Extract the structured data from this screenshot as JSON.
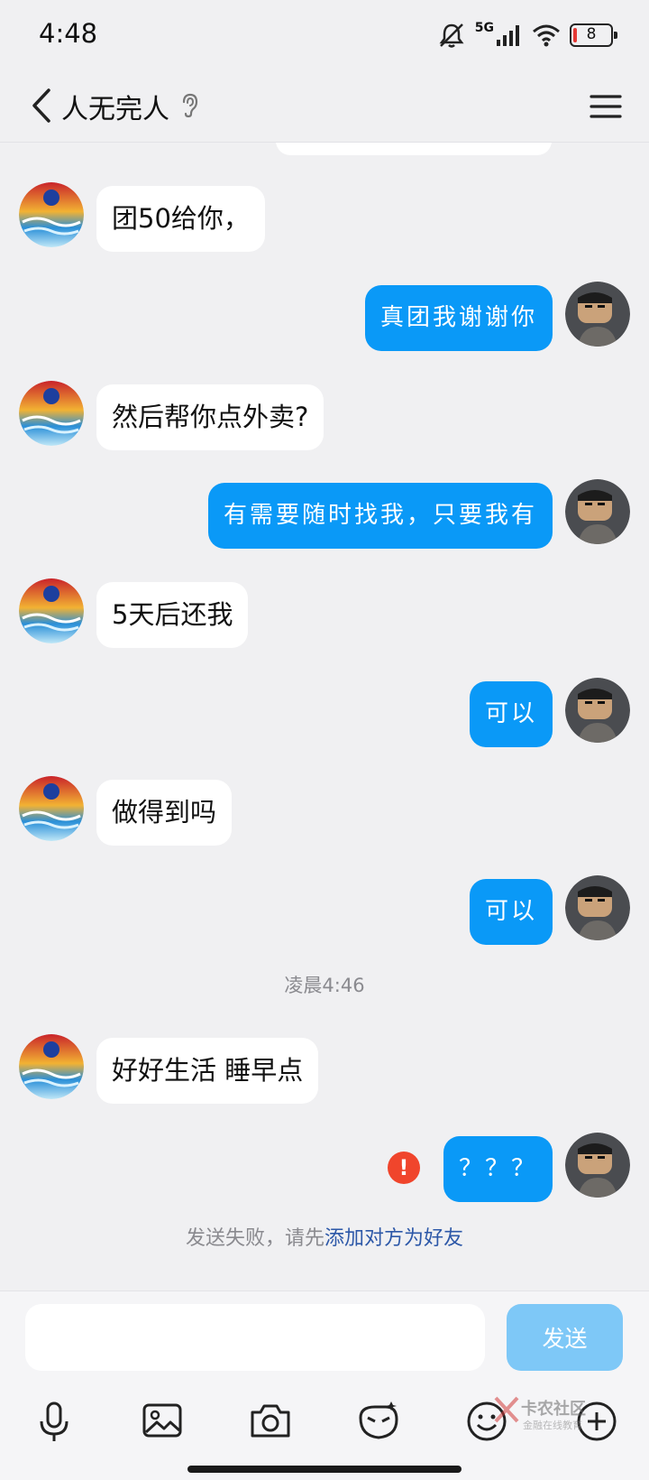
{
  "status_bar": {
    "time": "4:48",
    "network": "5G",
    "battery": "8",
    "icons": [
      "mute-icon",
      "signal-icon",
      "wifi-icon",
      "battery-icon"
    ]
  },
  "header": {
    "title": "人无完人",
    "back_icon": "chevron-left-icon",
    "ear_icon": "ear-icon",
    "menu_icon": "menu-icon"
  },
  "messages": [
    {
      "side": "in",
      "text": "团50给你，"
    },
    {
      "side": "out",
      "text": "真团我谢谢你"
    },
    {
      "side": "in",
      "text": "然后帮你点外卖?"
    },
    {
      "side": "out",
      "text": "有需要随时找我，只要我有"
    },
    {
      "side": "in",
      "text": "5天后还我"
    },
    {
      "side": "out",
      "text": "可以"
    },
    {
      "side": "in",
      "text": "做得到吗"
    },
    {
      "side": "out",
      "text": "可以"
    },
    {
      "side": "time",
      "text": "凌晨4:46"
    },
    {
      "side": "in",
      "text": "好好生活 睡早点"
    },
    {
      "side": "out",
      "text": "？？？",
      "failed": true
    }
  ],
  "error_mark": "!",
  "fail_notice": {
    "prefix": "发送失败，请先",
    "link": "添加对方为好友"
  },
  "composer": {
    "placeholder": "",
    "send_label": "发送"
  },
  "toolbar": [
    "microphone-icon",
    "image-icon",
    "camera-icon",
    "red-packet-icon",
    "emoji-icon",
    "plus-icon"
  ],
  "watermark": {
    "title": "卡农社区",
    "subtitle": "金融在线教育"
  },
  "colors": {
    "outgoing_bubble": "#0a99f7",
    "incoming_bubble": "#ffffff",
    "background": "#f0f0f2",
    "send_button": "#7ec8f7",
    "error": "#f0452c",
    "link": "#2d58a8"
  }
}
